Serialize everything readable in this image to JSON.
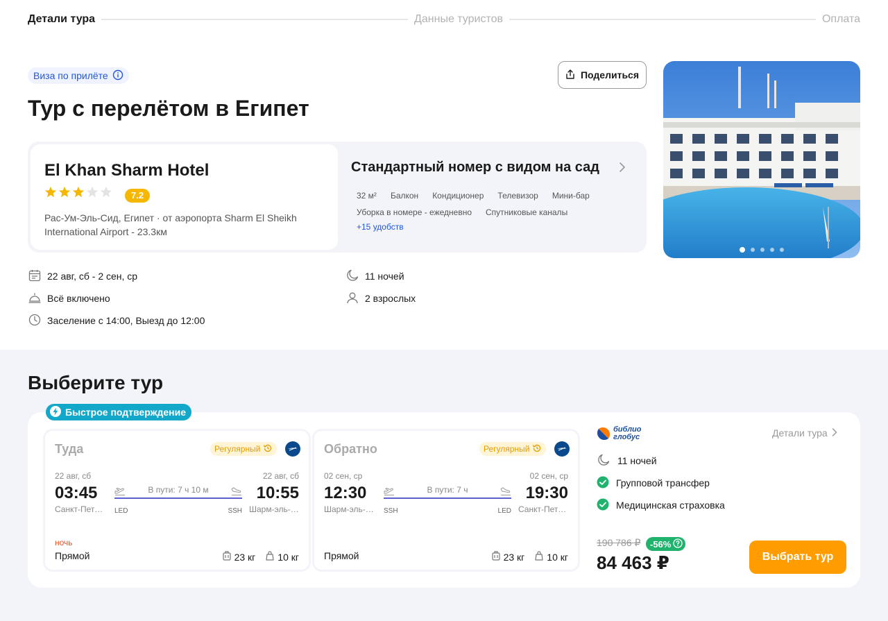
{
  "stepper": {
    "step1": "Детали тура",
    "step2": "Данные туристов",
    "step3": "Оплата"
  },
  "tour": {
    "visa_badge": "Виза по прилёте",
    "share_label": "Поделиться",
    "title": "Тур с перелётом в Египет"
  },
  "hotel": {
    "name": "El Khan Sharm Hotel",
    "stars": 3,
    "rating": "7.2",
    "location": "Рас-Ум-Эль-Сид, Египет · от аэропорта Sharm El Sheikh International Airport - 23.3км"
  },
  "room": {
    "title": "Стандартный номер с видом на сад",
    "amenities": [
      "32 м²",
      "Балкон",
      "Кондиционер",
      "Телевизор",
      "Мини-бар",
      "Уборка в номере - ежедневно",
      "Спутниковые каналы"
    ],
    "more": "+15 удобств"
  },
  "facts": {
    "dates": "22 авг, сб - 2 сен, ср",
    "meal": "Всё включено",
    "checkin": "Заселение с 14:00, Выезд до 12:00",
    "nights": "11 ночей",
    "guests": "2 взрослых"
  },
  "photo": {
    "slide_count": 5,
    "active_slide": 1
  },
  "offer": {
    "section_title": "Выберите тур",
    "fast_badge": "Быстрое подтверждение",
    "outbound": {
      "direction": "Туда",
      "flight_class": "Регулярный",
      "dep_date": "22 авг, сб",
      "dep_time": "03:45",
      "dep_city": "Санкт-Петербург",
      "arr_date": "22 авг, сб",
      "arr_time": "10:55",
      "arr_city": "Шарм-эль-Шейх",
      "duration": "В пути: 7 ч 10 м",
      "dep_code": "LED",
      "arr_code": "SSH",
      "night_tag": "ночь",
      "type": "Прямой",
      "baggage": "23 кг",
      "hand_luggage": "10 кг"
    },
    "inbound": {
      "direction": "Обратно",
      "flight_class": "Регулярный",
      "dep_date": "02 сен, ср",
      "dep_time": "12:30",
      "dep_city": "Шарм-эль-Шейх",
      "arr_date": "02 сен, ср",
      "arr_time": "19:30",
      "arr_city": "Санкт-Петербург",
      "duration": "В пути: 7 ч",
      "dep_code": "SSH",
      "arr_code": "LED",
      "type": "Прямой",
      "baggage": "23 кг",
      "hand_luggage": "10 кг"
    },
    "operator": {
      "line1": "библио",
      "line2": "глобус"
    },
    "details_link": "Детали тура",
    "perks": {
      "nights": "11 ночей",
      "transfer": "Групповой трансфер",
      "insurance": "Медицинская страховка"
    },
    "old_price": "190 786 ₽",
    "discount": "-56%",
    "price": "84 463 ₽",
    "choose_label": "Выбрать тур"
  },
  "colors": {
    "accent_orange": "#ff9d00",
    "link_blue": "#2456d6",
    "rating_yellow": "#f5b700",
    "fast_badge": "#13a8c9",
    "discount_green": "#1fb36d",
    "route_line": "#5b5fd6"
  }
}
